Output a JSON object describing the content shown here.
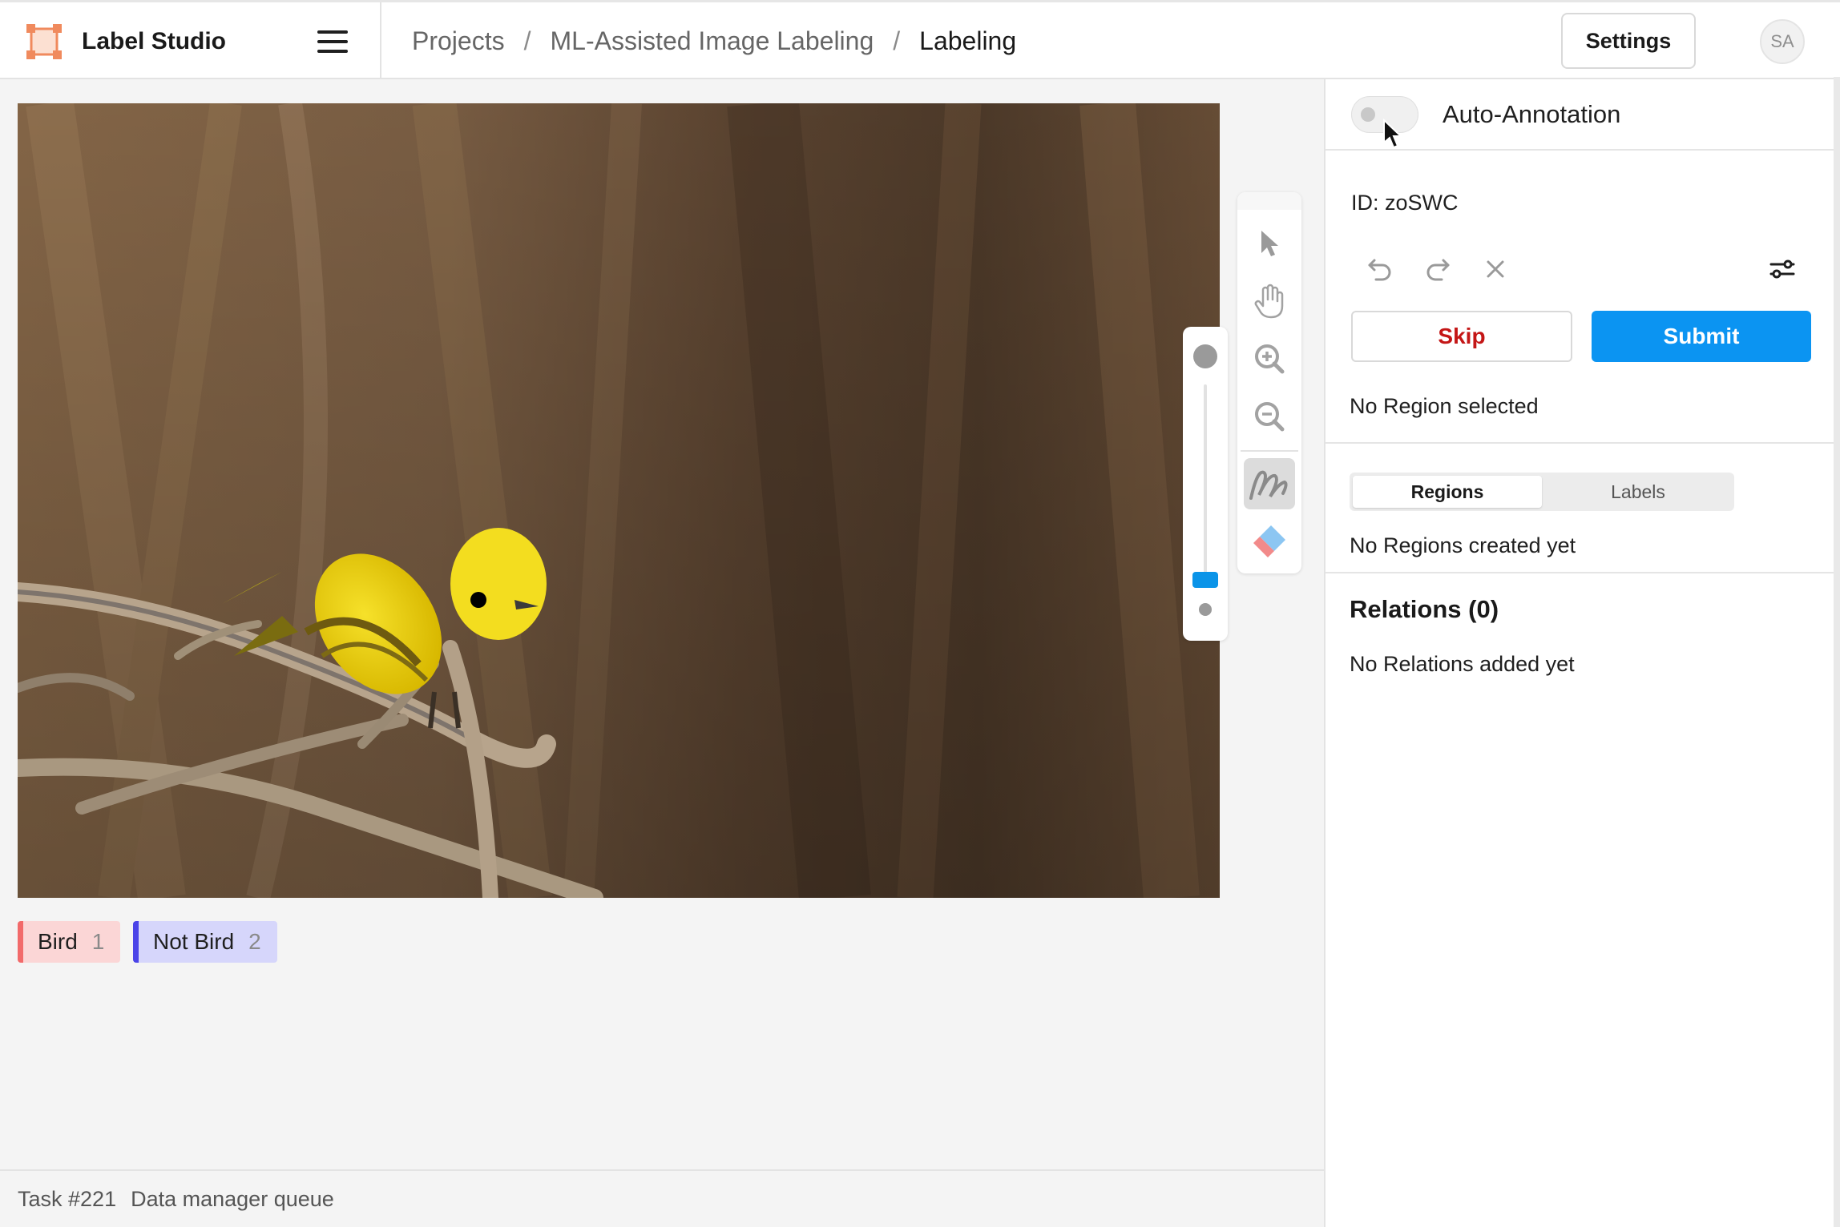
{
  "app": {
    "title": "Label Studio",
    "logo_icon": "label-studio-logo-icon"
  },
  "header": {
    "menu_icon": "hamburger-menu-icon",
    "breadcrumb": [
      {
        "label": "Projects"
      },
      {
        "label": "ML-Assisted Image Labeling"
      },
      {
        "label": "Labeling"
      }
    ],
    "separator": "/",
    "settings_label": "Settings",
    "avatar_initials": "SA"
  },
  "canvas": {
    "image_subject": "yellow bird perched on branch",
    "zoom": {
      "level": 0.9
    }
  },
  "tools": [
    {
      "name": "select-tool",
      "icon": "cursor-arrow-icon",
      "active": false
    },
    {
      "name": "pan-tool",
      "icon": "hand-icon",
      "active": false
    },
    {
      "name": "zoom-in-tool",
      "icon": "zoom-in-icon",
      "active": false
    },
    {
      "name": "zoom-out-tool",
      "icon": "zoom-out-icon",
      "active": false
    },
    {
      "name": "brush-tool",
      "icon": "brush-stroke-icon",
      "active": true
    },
    {
      "name": "eraser-tool",
      "icon": "eraser-icon",
      "active": false
    }
  ],
  "labels": [
    {
      "name": "Bird",
      "hotkey": "1",
      "color": "#f26a6a",
      "bg": "#fbd6d6"
    },
    {
      "name": "Not Bird",
      "hotkey": "2",
      "color": "#4b44e8",
      "bg": "#d6d6fb"
    }
  ],
  "footer": {
    "task": "Task #221",
    "queue": "Data manager queue"
  },
  "panel": {
    "auto_annotation_label": "Auto-Annotation",
    "auto_annotation_enabled": false,
    "id_label": "ID: zoSWC",
    "controls": [
      "undo-icon",
      "redo-icon",
      "clear-icon",
      "settings-sliders-icon"
    ],
    "skip_label": "Skip",
    "submit_label": "Submit",
    "region_status": "No Region selected",
    "tabs": [
      {
        "label": "Regions",
        "active": true
      },
      {
        "label": "Labels",
        "active": false
      }
    ],
    "regions_empty": "No Regions created yet",
    "relations_title": "Relations (0)",
    "relations_empty": "No Relations added yet"
  },
  "colors": {
    "accent": "#0b94f2",
    "skip": "#c41616",
    "logo": "#f08a5d"
  }
}
